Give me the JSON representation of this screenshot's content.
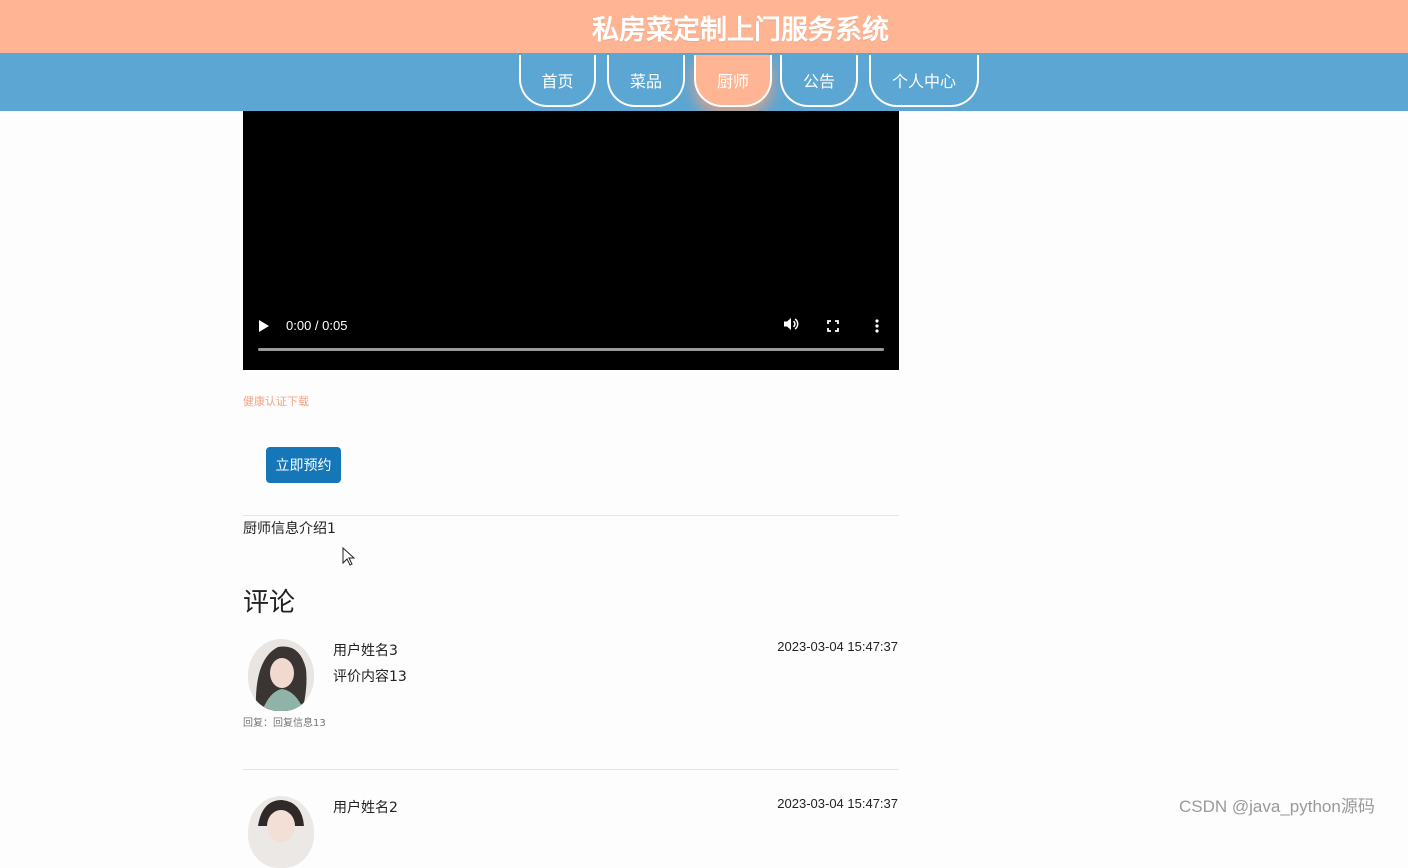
{
  "app": {
    "title": "私房菜定制上门服务系统"
  },
  "nav": {
    "items": [
      {
        "label": "首页"
      },
      {
        "label": "菜品"
      },
      {
        "label": "厨师",
        "active": true
      },
      {
        "label": "公告"
      },
      {
        "label": "个人中心"
      }
    ]
  },
  "video": {
    "time": "0:00 / 0:05",
    "progress": 0,
    "icons": [
      "play-icon",
      "volume-icon",
      "fullscreen-icon",
      "more-options-icon"
    ]
  },
  "chef": {
    "cert_link": "健康认证下载",
    "book_button": "立即预约",
    "intro": "厨师信息介绍1"
  },
  "comments": {
    "title": "评论",
    "items": [
      {
        "user": "用户姓名3",
        "time": "2023-03-04 15:47:37",
        "content": "评价内容13",
        "reply": "回复：回复信息13"
      },
      {
        "user": "用户姓名2",
        "time": "2023-03-04 15:47:37"
      }
    ]
  },
  "watermark": "CSDN @java_python源码",
  "colors": {
    "header": "#ffb593",
    "nav": "#5ba6d3",
    "primary_button": "#1677b8",
    "link": "#f4a183"
  }
}
